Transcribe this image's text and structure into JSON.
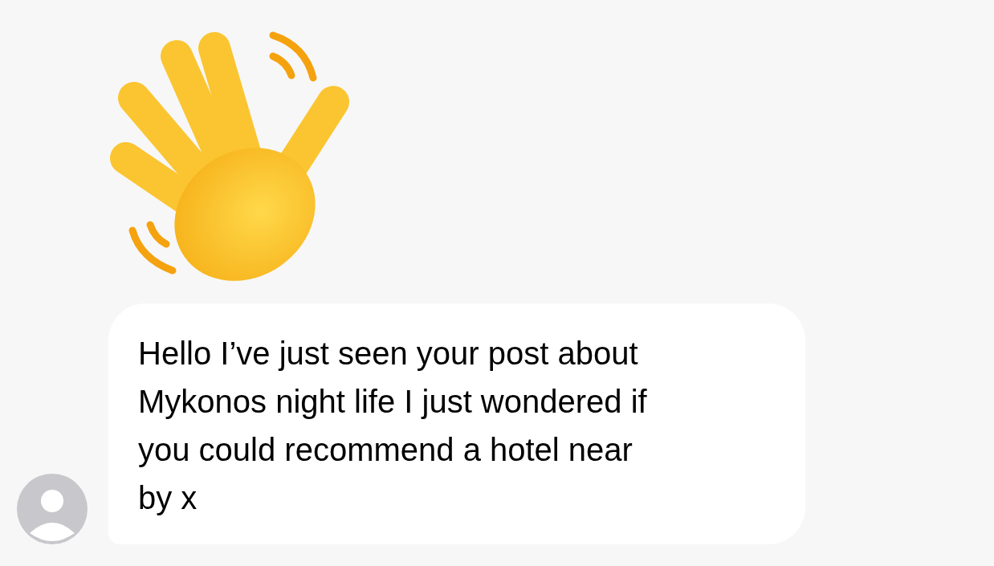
{
  "messages": [
    {
      "kind": "sticker"
    },
    {
      "kind": "text",
      "lines": [
        "Hello I’ve just seen your post about",
        "Mykonos night life I just wondered if",
        "you could recommend a hotel near",
        "by x"
      ]
    }
  ]
}
